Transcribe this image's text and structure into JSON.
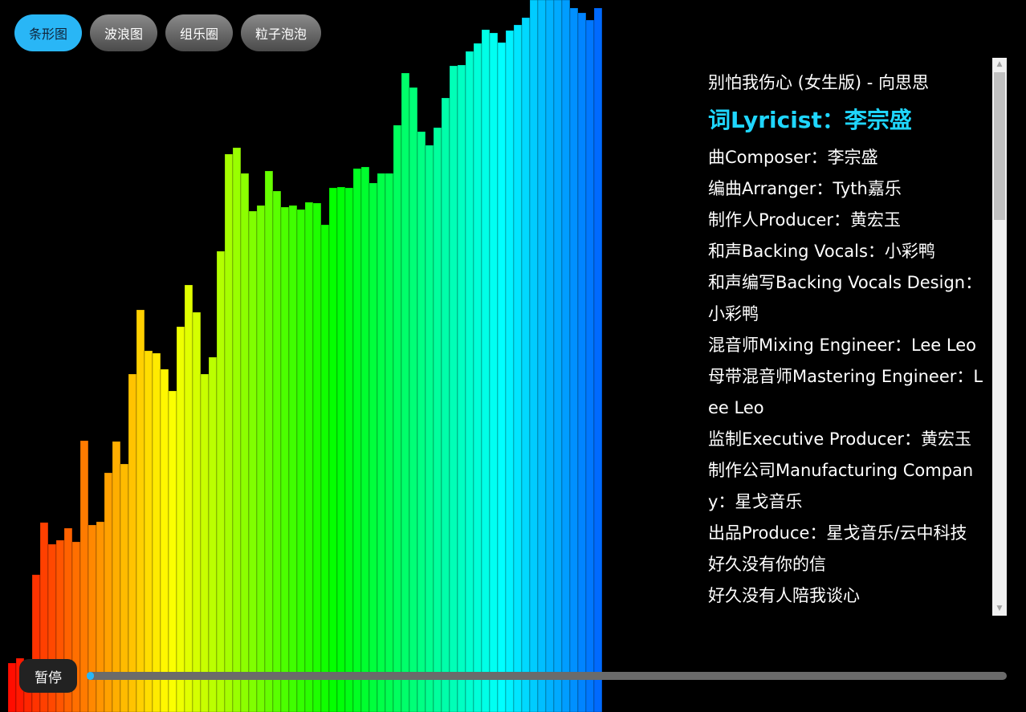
{
  "modes": [
    {
      "label": "条形图",
      "active": true
    },
    {
      "label": "波浪图",
      "active": false
    },
    {
      "label": "组乐圈",
      "active": false
    },
    {
      "label": "粒子泡泡",
      "active": false
    }
  ],
  "lyrics": {
    "lines": [
      "别怕我伤心 (女生版) - 向思思",
      "词Lyricist：李宗盛",
      "曲Composer：李宗盛",
      "编曲Arranger：Tyth嘉乐",
      "制作人Producer：黄宏玉",
      "和声Backing Vocals：小彩鸭",
      "和声编写Backing Vocals Design：小彩鸭",
      "混音师Mixing Engineer：Lee Leo",
      "母带混音师Mastering Engineer：Lee Leo",
      "监制Executive Producer：黄宏玉",
      "制作公司Manufacturing Company：星戈音乐",
      "出品Produce：星戈音乐/云中科技",
      "好久没有你的信",
      "好久没有人陪我谈心"
    ],
    "active_index": 1
  },
  "controls": {
    "pause_label": "暂停",
    "progress": 0.008
  },
  "spectrum": {
    "bar_count": 75,
    "values": [
      887,
      826,
      820,
      827,
      716,
      651,
      678,
      673,
      658,
      675,
      549,
      654,
      650,
      589,
      550,
      578,
      466,
      386,
      437,
      440,
      460,
      487,
      407,
      355,
      389,
      466,
      445,
      313,
      192,
      184,
      216,
      263,
      256,
      213,
      238,
      258,
      256,
      261,
      252,
      253,
      280,
      234,
      233,
      234,
      210,
      208,
      228,
      216,
      216,
      156,
      91,
      109,
      164,
      181,
      159,
      122,
      82,
      81,
      64,
      54,
      37,
      41,
      53,
      38,
      31,
      22,
      0,
      0,
      0,
      0,
      0,
      10,
      16,
      25,
      10
    ],
    "colors": {
      "start": "#ff0000",
      "end": "#0050ff"
    }
  }
}
